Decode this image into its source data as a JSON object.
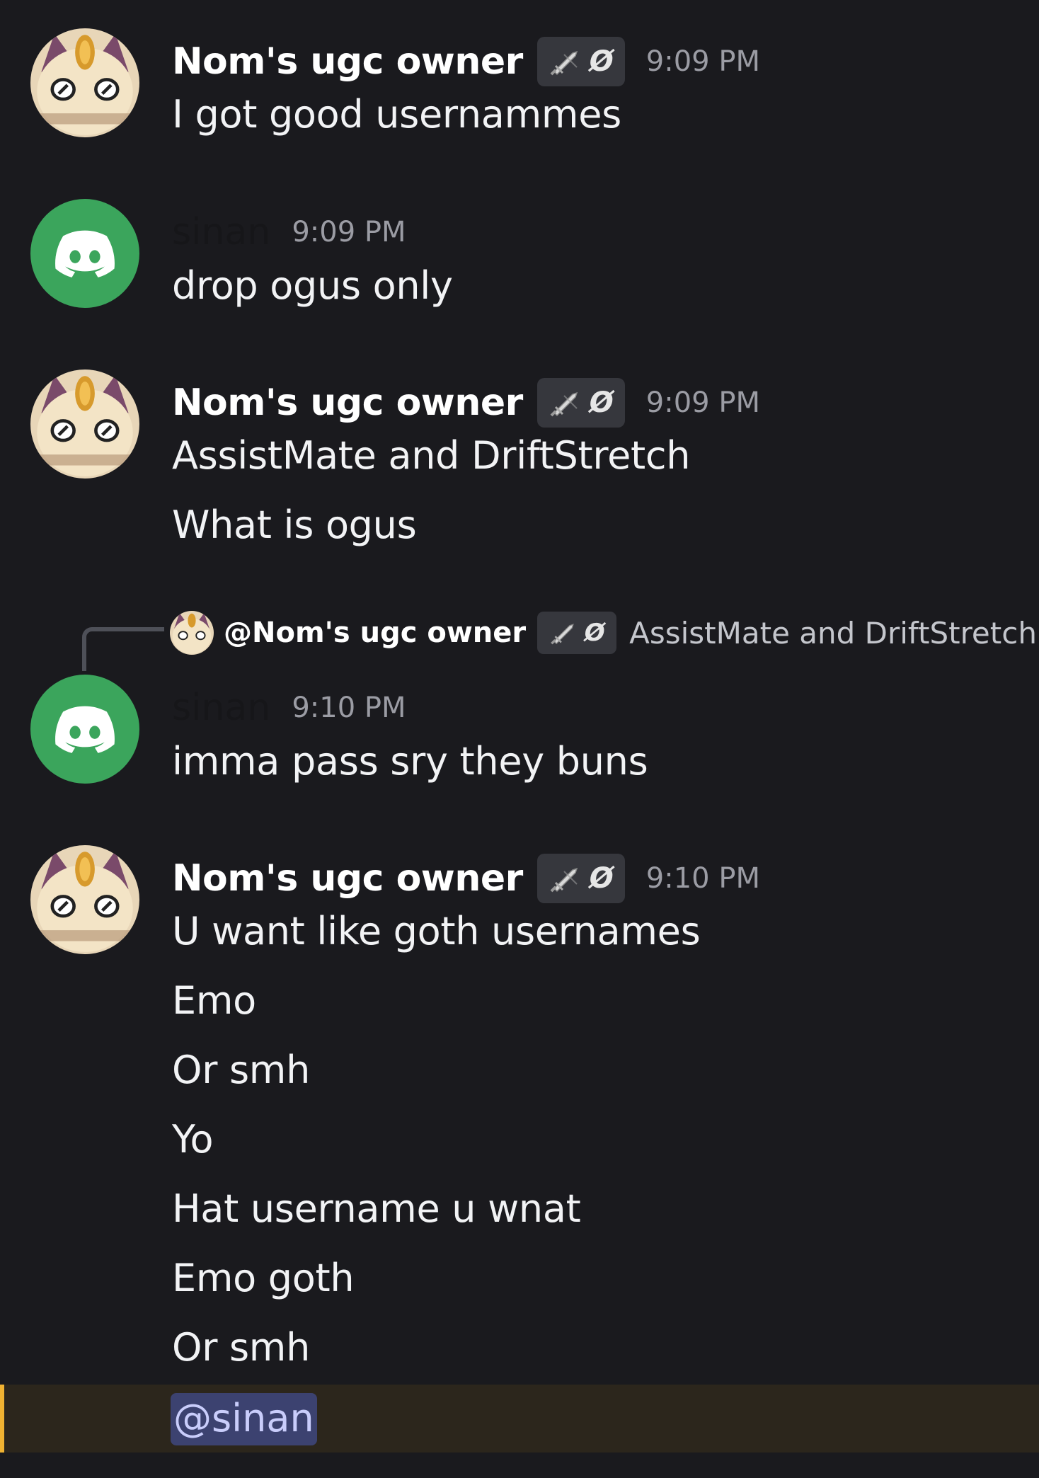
{
  "colors": {
    "background": "#1a1a1e",
    "discord_green": "#3ba55c",
    "mention_highlight": "#2c261c",
    "mention_bar": "#f0b232",
    "mention_pill": "#3c4270"
  },
  "messages": [
    {
      "author": "Nom's ugc owner",
      "tag": "Ø",
      "tag_icon": "sword-icon",
      "time": "9:09 PM",
      "lines": [
        "I got good usernammes"
      ]
    },
    {
      "author": "sinan",
      "time": "9:09 PM",
      "lines": [
        "drop ogus only"
      ]
    },
    {
      "author": "Nom's ugc owner",
      "tag": "Ø",
      "tag_icon": "sword-icon",
      "time": "9:09 PM",
      "lines": [
        "AssistMate and DriftStretch",
        "What is ogus"
      ]
    },
    {
      "reply_to": {
        "author": "@Nom's ugc owner",
        "tag": "Ø",
        "preview": "AssistMate and DriftStretch"
      },
      "author": "sinan",
      "time": "9:10 PM",
      "lines": [
        "imma pass sry they buns"
      ]
    },
    {
      "author": "Nom's ugc owner",
      "tag": "Ø",
      "tag_icon": "sword-icon",
      "time": "9:10 PM",
      "lines": [
        "U want like goth usernames",
        "Emo",
        "Or smh",
        "Yo",
        "Hat username u wnat",
        "Emo goth",
        "Or smh"
      ],
      "mention": "@sinan"
    }
  ]
}
